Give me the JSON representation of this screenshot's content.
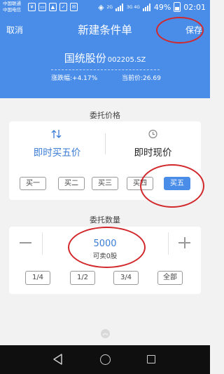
{
  "status_bar": {
    "carrier_1": "中国联通",
    "carrier_2": "中国电信",
    "network_1": "2G",
    "network_2": "3G 4G",
    "battery": "49%",
    "time": "02:01"
  },
  "header": {
    "cancel_label": "取消",
    "title": "新建条件单",
    "save_label": "保存",
    "stock_name": "国统股份",
    "stock_code": "002205.SZ",
    "change_text": "涨跌幅:+4.17%",
    "price_text": "当前价:26.69"
  },
  "price_section": {
    "title": "委托价格",
    "options": [
      {
        "label": "即时买五价",
        "icon": "sort-arrows-icon",
        "selected": true
      },
      {
        "label": "即时现价",
        "icon": "clock-icon",
        "selected": false
      }
    ],
    "levels": [
      "买一",
      "买二",
      "买三",
      "买四",
      "买五"
    ],
    "active_level": "买五"
  },
  "quantity_section": {
    "title": "委托数量",
    "value": "5000",
    "available": "可卖0股",
    "fractions": [
      "1/4",
      "1/2",
      "3/4",
      "全部"
    ]
  },
  "colors": {
    "primary": "#4a8de8",
    "highlight_ring": "#d2282b"
  }
}
